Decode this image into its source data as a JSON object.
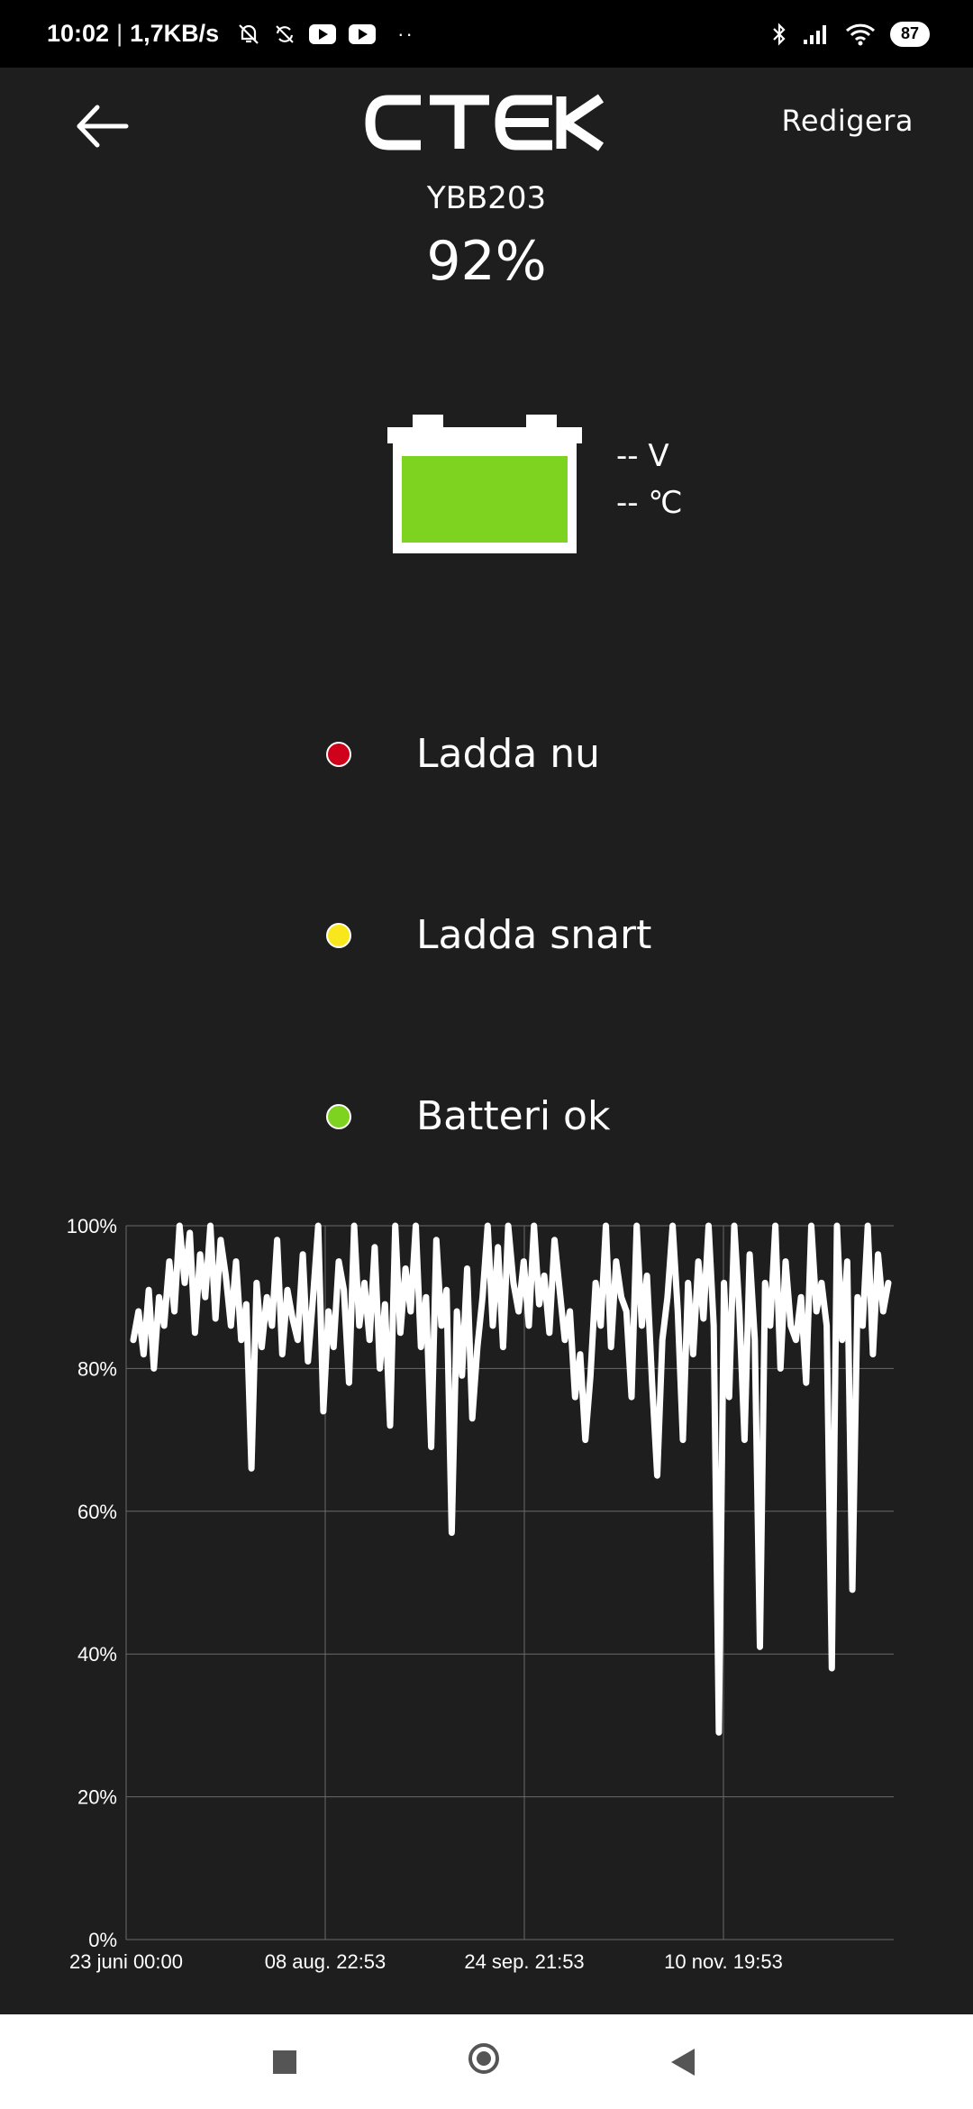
{
  "status_bar": {
    "time": "10:02",
    "speed": "1,7KB/s",
    "battery": "87",
    "icons": [
      "alarm-off-icon",
      "sync-icon",
      "youtube-icon",
      "youtube-icon",
      "more-dots-icon",
      "bluetooth-icon",
      "signal-icon",
      "wifi-icon",
      "battery-icon"
    ]
  },
  "header": {
    "logo": "CTEK",
    "edit_label": "Redigera",
    "back_icon": "arrow-left-icon"
  },
  "device": {
    "name": "YBB203",
    "charge": "92%",
    "charge_level": 0.92,
    "voltage": "-- V",
    "temperature": "-- ℃",
    "battery_color": "#7ed321"
  },
  "legend": [
    {
      "label": "Ladda nu",
      "color": "#d0021b"
    },
    {
      "label": "Ladda snart",
      "color": "#f8e71c"
    },
    {
      "label": "Batteri ok",
      "color": "#7ed321"
    }
  ],
  "chart_data": {
    "type": "line",
    "title": "",
    "xlabel": "",
    "ylabel": "",
    "ylim": [
      0,
      100
    ],
    "y_ticks": [
      "0%",
      "20%",
      "40%",
      "60%",
      "80%",
      "100%"
    ],
    "x_ticks": [
      "23 juni 00:00",
      "08 aug. 22:53",
      "24 sep. 21:53",
      "10 nov. 19:53"
    ],
    "grid": true,
    "series": [
      {
        "color": "#ffffff",
        "values": [
          84,
          88,
          82,
          91,
          80,
          90,
          86,
          95,
          88,
          100,
          92,
          99,
          85,
          96,
          90,
          100,
          87,
          98,
          93,
          86,
          95,
          84,
          89,
          66,
          92,
          83,
          90,
          86,
          98,
          82,
          91,
          87,
          84,
          96,
          81,
          90,
          100,
          74,
          88,
          83,
          95,
          91,
          78,
          100,
          86,
          92,
          84,
          97,
          80,
          89,
          72,
          100,
          85,
          94,
          88,
          100,
          83,
          90,
          69,
          98,
          86,
          91,
          57,
          88,
          79,
          94,
          73,
          83,
          90,
          100,
          86,
          97,
          83,
          100,
          92,
          88,
          95,
          86,
          100,
          89,
          93,
          85,
          98,
          91,
          84,
          88,
          76,
          82,
          70,
          79,
          92,
          86,
          100,
          83,
          95,
          90,
          88,
          76,
          100,
          86,
          93,
          78,
          65,
          84,
          90,
          100,
          88,
          70,
          92,
          82,
          95,
          87,
          100,
          86,
          29,
          92,
          76,
          100,
          88,
          70,
          96,
          84,
          41,
          92,
          86,
          100,
          80,
          95,
          86,
          84,
          90,
          78,
          100,
          88,
          92,
          86,
          38,
          100,
          84,
          95,
          49,
          90,
          86,
          100,
          82,
          96,
          88,
          92
        ]
      }
    ]
  },
  "nav": {
    "icons": [
      "recents-square-icon",
      "home-circle-icon",
      "back-triangle-icon"
    ]
  }
}
